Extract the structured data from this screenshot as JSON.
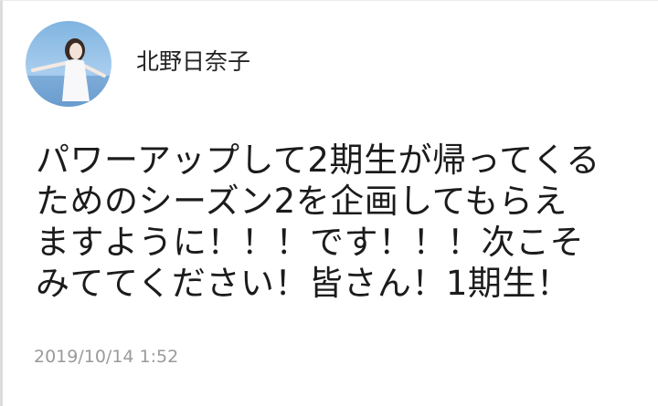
{
  "post": {
    "user_name": "北野日奈子",
    "avatar_icon": "profile-photo",
    "body_lines": [
      "パワーアップして2期生が帰ってくる",
      "ためのシーズン2を企画してもらえ",
      "ますように！！！です！！！次こそ",
      "みててください！皆さん！1期生！"
    ],
    "timestamp": "2019/10/14 1:52"
  },
  "colors": {
    "text": "#1b1b1b",
    "timestamp": "#9a9a9a",
    "background": "#ffffff"
  }
}
